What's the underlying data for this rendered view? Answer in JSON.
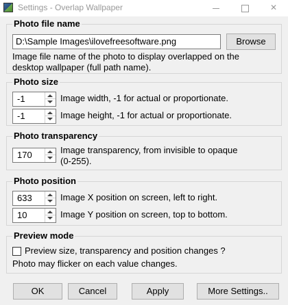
{
  "window": {
    "title": "Settings - Overlap Wallpaper",
    "app_icon": "wallpaper-app-icon"
  },
  "photo_file": {
    "legend": "Photo file name",
    "path_value": "D:\\Sample Images\\ilovefreesoftware.png",
    "browse_label": "Browse",
    "description": [
      "Image file name of the photo to display overlapped on the",
      "desktop wallpaper (full path name)."
    ]
  },
  "photo_size": {
    "legend": "Photo size",
    "width_value": "-1",
    "width_desc": "Image width, -1 for actual or proportionate.",
    "height_value": "-1",
    "height_desc": "Image height, -1 for actual or proportionate."
  },
  "photo_transparency": {
    "legend": "Photo transparency",
    "value": "170",
    "desc": [
      "Image transparency, from invisible to opaque",
      "(0-255)."
    ]
  },
  "photo_position": {
    "legend": "Photo position",
    "x_value": "633",
    "x_desc": "Image X position on screen, left to right.",
    "y_value": "10",
    "y_desc": "Image Y position on screen, top to bottom."
  },
  "preview_mode": {
    "legend": "Preview mode",
    "checkbox_label": "Preview size, transparency and position changes ?",
    "checked": false,
    "note": "Photo may flicker on each value changes."
  },
  "buttons": {
    "ok": "OK",
    "cancel": "Cancel",
    "apply": "Apply",
    "more": "More Settings.."
  }
}
